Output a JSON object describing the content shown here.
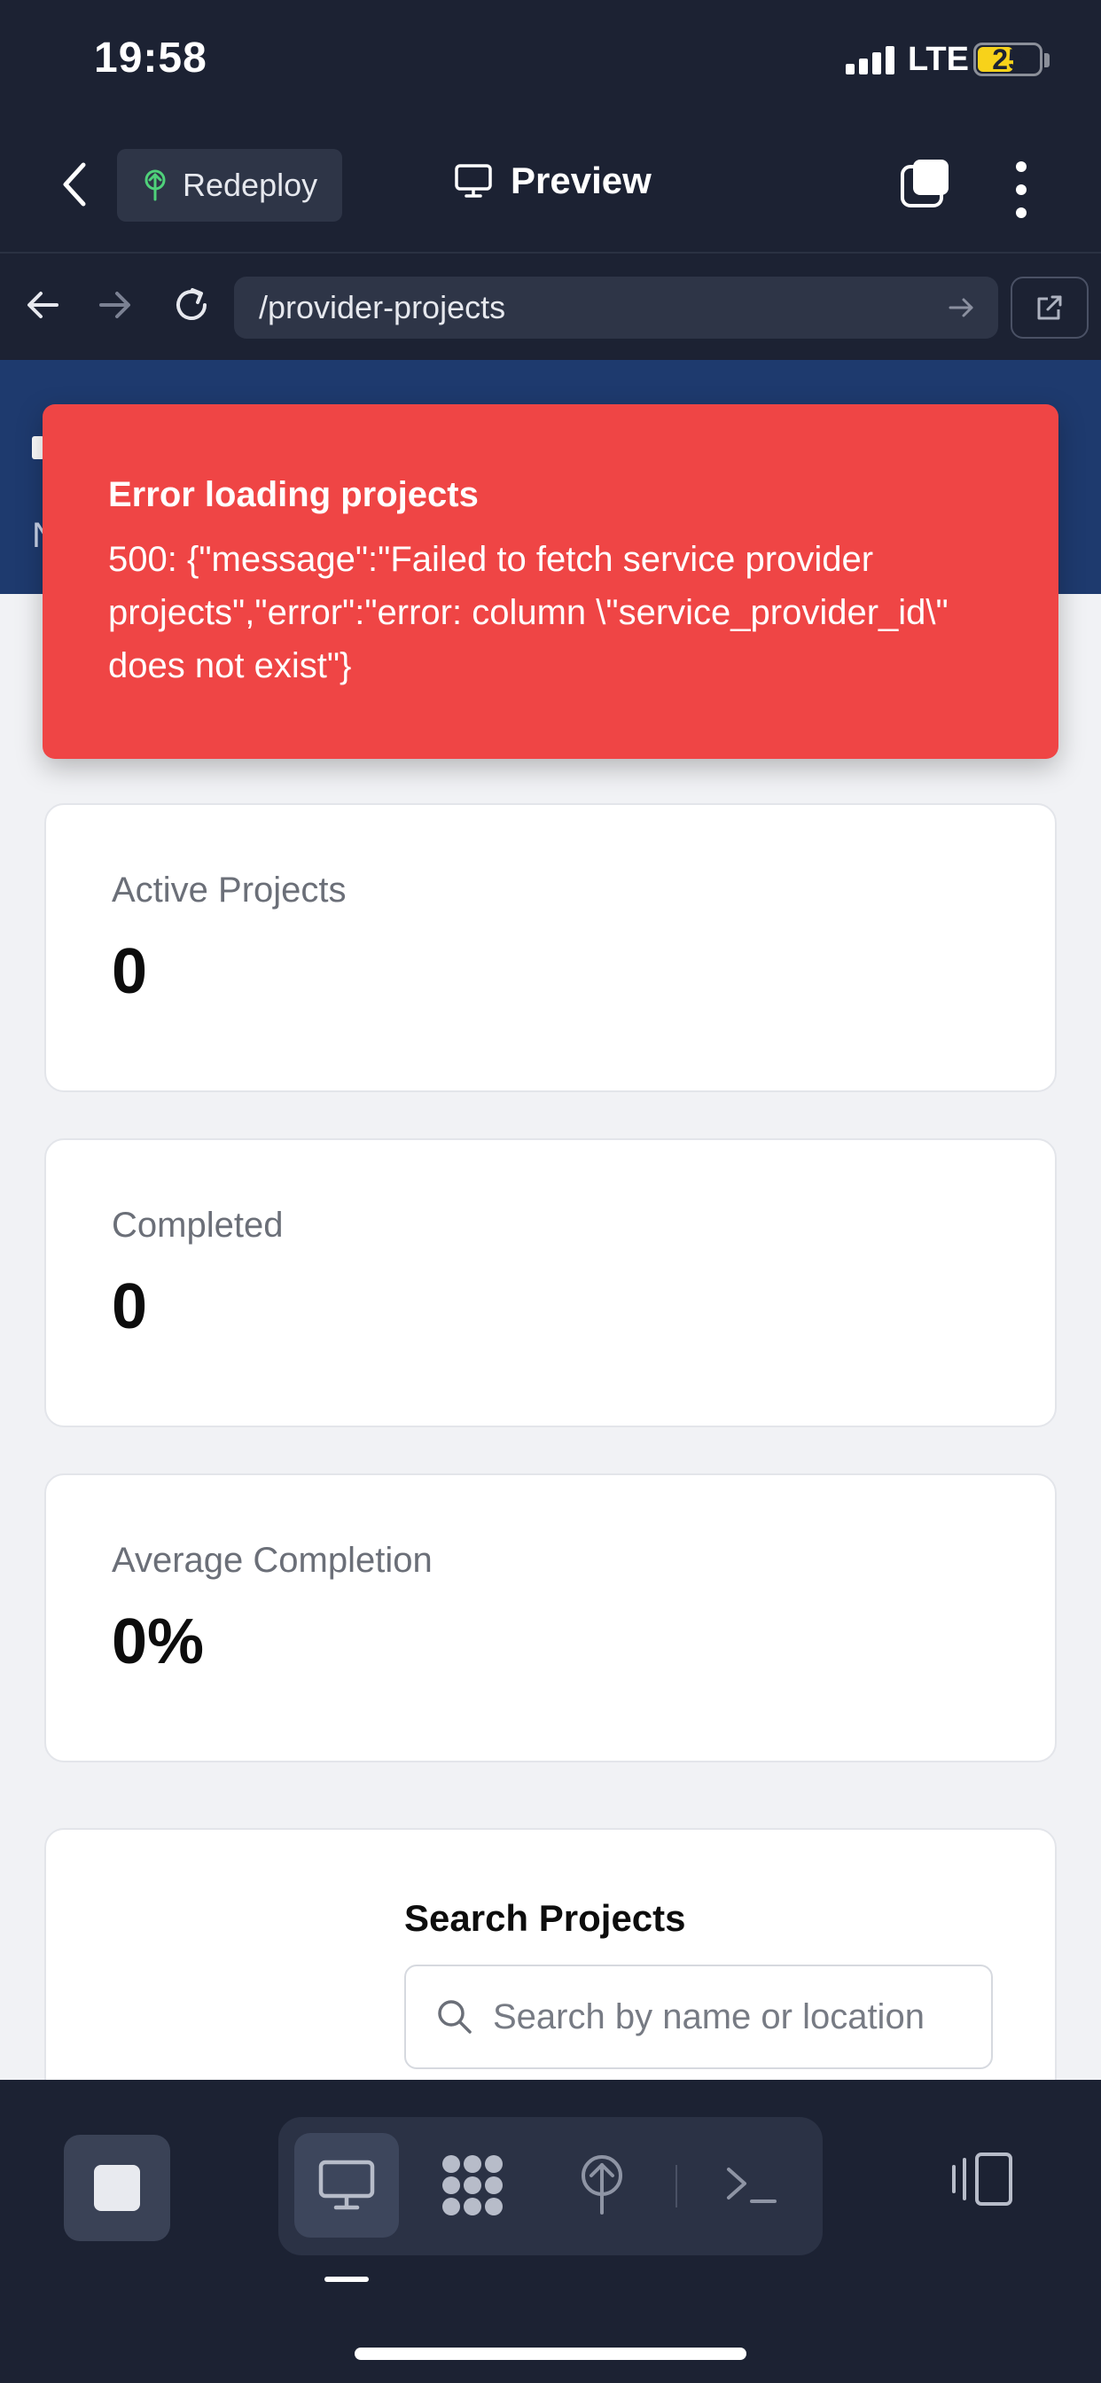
{
  "status_bar": {
    "time": "19:58",
    "network": "LTE",
    "battery": "25"
  },
  "header": {
    "back_icon": "chevron-left-icon",
    "redeploy_label": "Redeploy",
    "redeploy_icon": "deploy-tree-icon",
    "preview_label": "Preview",
    "preview_icon": "monitor-icon",
    "tabs_icon": "tabs-icon",
    "more_icon": "more-vertical-icon"
  },
  "browser": {
    "url": "/provider-projects",
    "back_icon": "arrow-left-icon",
    "forward_icon": "arrow-right-icon",
    "reload_icon": "reload-icon",
    "go_icon": "arrow-right-icon",
    "external_icon": "external-link-icon"
  },
  "hero": {
    "peek_1": "",
    "peek_2": "N"
  },
  "error": {
    "title": "Error loading projects",
    "message": "500: {\"message\":\"Failed to fetch service provider projects\",\"error\":\"error: column \\\"service_provider_id\\\" does not exist\"}",
    "background": "#ef4545"
  },
  "stats": [
    {
      "label": "Active Projects",
      "value": "0"
    },
    {
      "label": "Completed",
      "value": "0"
    },
    {
      "label": "Average Completion",
      "value": "0%"
    }
  ],
  "search": {
    "label": "Search Projects",
    "placeholder": "Search by name or location",
    "icon": "search-icon"
  },
  "toolbar": {
    "stop_icon": "stop-icon",
    "tools": [
      {
        "name": "preview",
        "icon": "monitor-icon",
        "active": true
      },
      {
        "name": "workflows",
        "icon": "workflow-icon",
        "active": false
      },
      {
        "name": "deployments",
        "icon": "deploy-tree-icon",
        "active": false
      },
      {
        "name": "shell",
        "icon": "terminal-icon",
        "active": false
      }
    ],
    "panel_icon": "panel-toggle-icon"
  }
}
